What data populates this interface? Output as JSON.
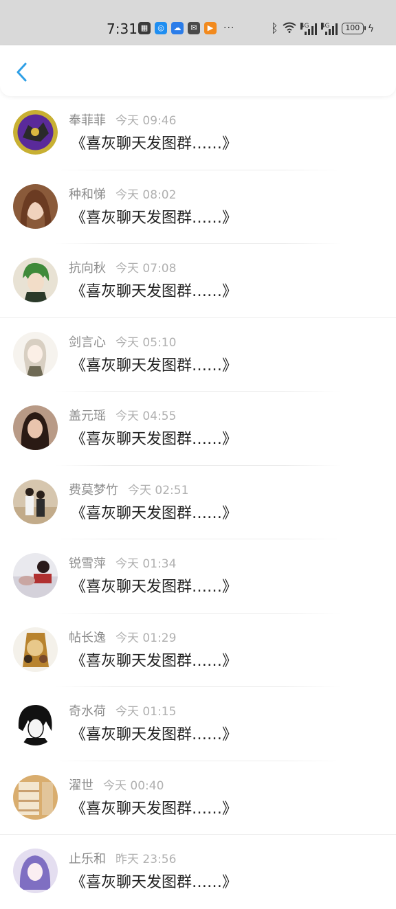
{
  "status_bar": {
    "time": "7:31",
    "dots": "···",
    "net1": "4G",
    "net2": "4G",
    "battery": "100"
  },
  "nav": {
    "back_icon": "chevron-left-icon"
  },
  "messages": [
    {
      "name": "奉菲菲",
      "time": "今天 09:46",
      "text": "《喜灰聊天发图群……》"
    },
    {
      "name": "种和悌",
      "time": "今天 08:02",
      "text": "《喜灰聊天发图群……》"
    },
    {
      "name": "抗向秋",
      "time": "今天 07:08",
      "text": "《喜灰聊天发图群……》"
    },
    {
      "name": "剑言心",
      "time": "今天 05:10",
      "text": "《喜灰聊天发图群……》"
    },
    {
      "name": "盖元瑶",
      "time": "今天 04:55",
      "text": "《喜灰聊天发图群……》"
    },
    {
      "name": "费莫梦竹",
      "time": "今天 02:51",
      "text": "《喜灰聊天发图群……》"
    },
    {
      "name": "锐雪萍",
      "time": "今天 01:34",
      "text": "《喜灰聊天发图群……》"
    },
    {
      "name": "帖长逸",
      "time": "今天 01:29",
      "text": "《喜灰聊天发图群……》"
    },
    {
      "name": "奇水荷",
      "time": "今天 01:15",
      "text": "《喜灰聊天发图群……》"
    },
    {
      "name": "濯世",
      "time": "今天 00:40",
      "text": "《喜灰聊天发图群……》"
    },
    {
      "name": "止乐和",
      "time": "昨天 23:56",
      "text": "《喜灰聊天发图群……》"
    }
  ],
  "colors": {
    "accent": "#2e9fe6",
    "name": "#8c8c8c",
    "time": "#b0b0b0",
    "text": "#222222"
  }
}
